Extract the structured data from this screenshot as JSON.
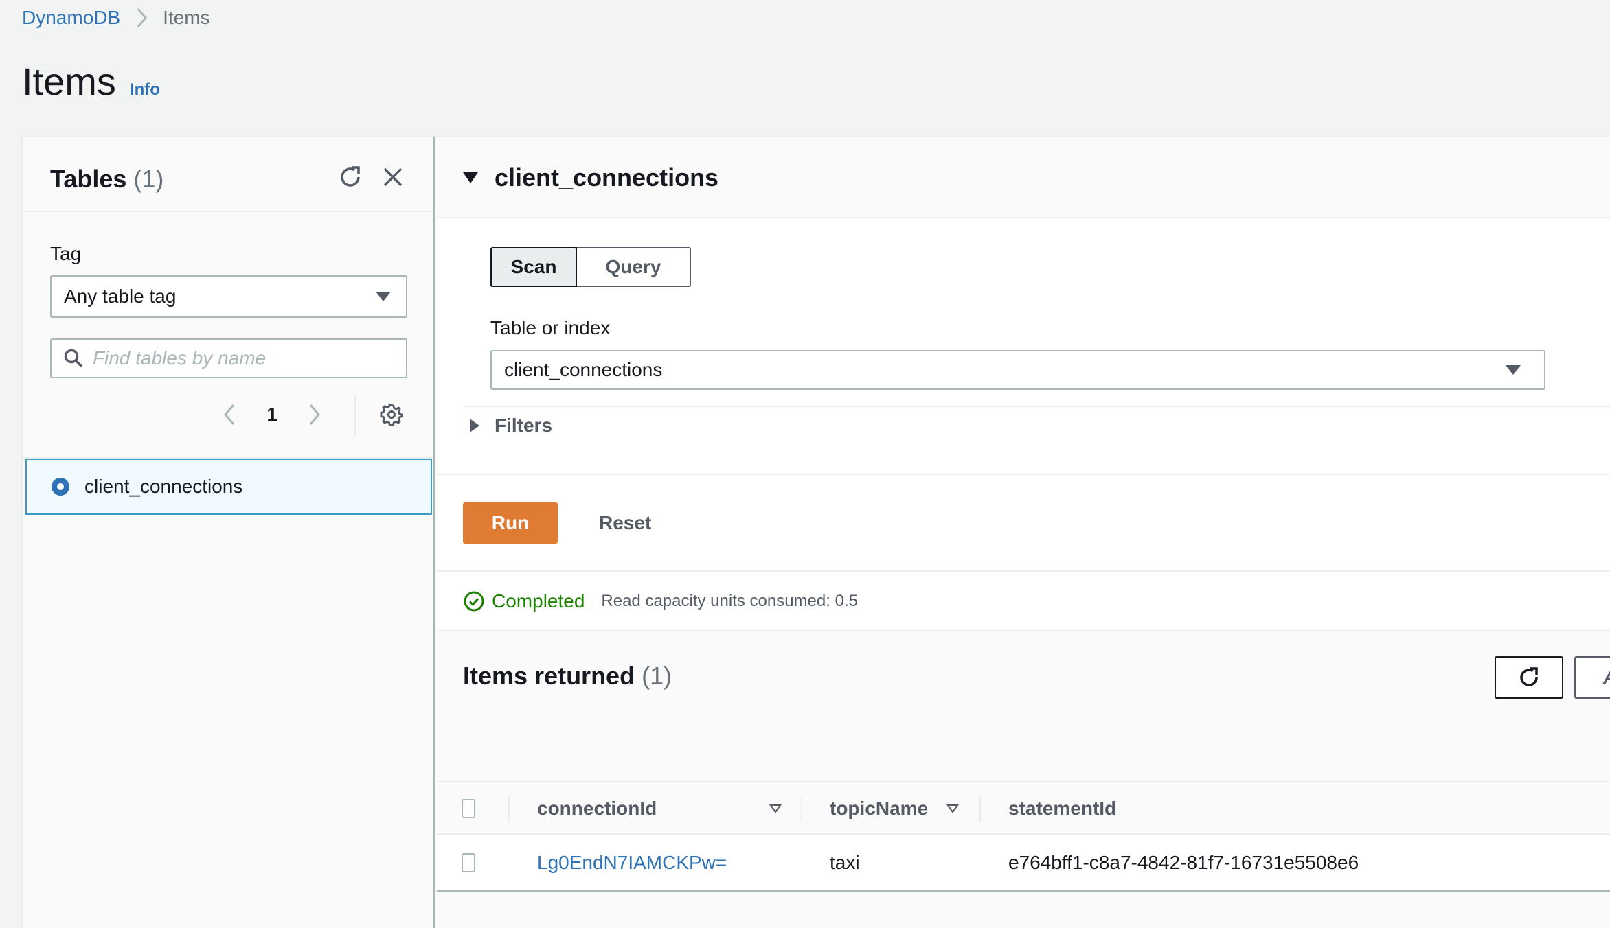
{
  "breadcrumb": {
    "items": [
      {
        "label": "DynamoDB"
      },
      {
        "label": "Items"
      }
    ]
  },
  "page": {
    "title": "Items",
    "info_label": "Info"
  },
  "tables_panel": {
    "title": "Tables",
    "count": "(1)",
    "tag_label": "Tag",
    "tag_value": "Any table tag",
    "search_placeholder": "Find tables by name",
    "search_value": "",
    "current_page": "1",
    "tables": [
      {
        "name": "client_connections",
        "selected": true
      }
    ]
  },
  "main": {
    "table_name": "client_connections",
    "mode_tabs": [
      {
        "label": "Scan",
        "selected": true
      },
      {
        "label": "Query",
        "selected": false
      }
    ],
    "table_or_index_label": "Table or index",
    "table_or_index_value": "client_connections",
    "filters_label": "Filters",
    "run_label": "Run",
    "reset_label": "Reset",
    "status": {
      "label": "Completed",
      "detail": "Read capacity units consumed: 0.5",
      "color": "#1d8102"
    },
    "items_returned": {
      "title": "Items returned",
      "count": "(1)",
      "actions_label_partial": "A",
      "columns": [
        {
          "label": "connectionId",
          "sortable": true
        },
        {
          "label": "topicName",
          "sortable": true
        },
        {
          "label": "statementId",
          "sortable": false
        }
      ],
      "rows": [
        {
          "connectionId": "Lg0EndN7IAMCKPw=",
          "topicName": "taxi",
          "statementId": "e764bff1-c8a7-4842-81f7-16731e5508e6"
        }
      ]
    }
  },
  "colors": {
    "link": "#2e73b8",
    "primary_button": "#e07b34",
    "selected_item_border": "#3b9bc4",
    "selected_item_bg": "#f1faff"
  }
}
